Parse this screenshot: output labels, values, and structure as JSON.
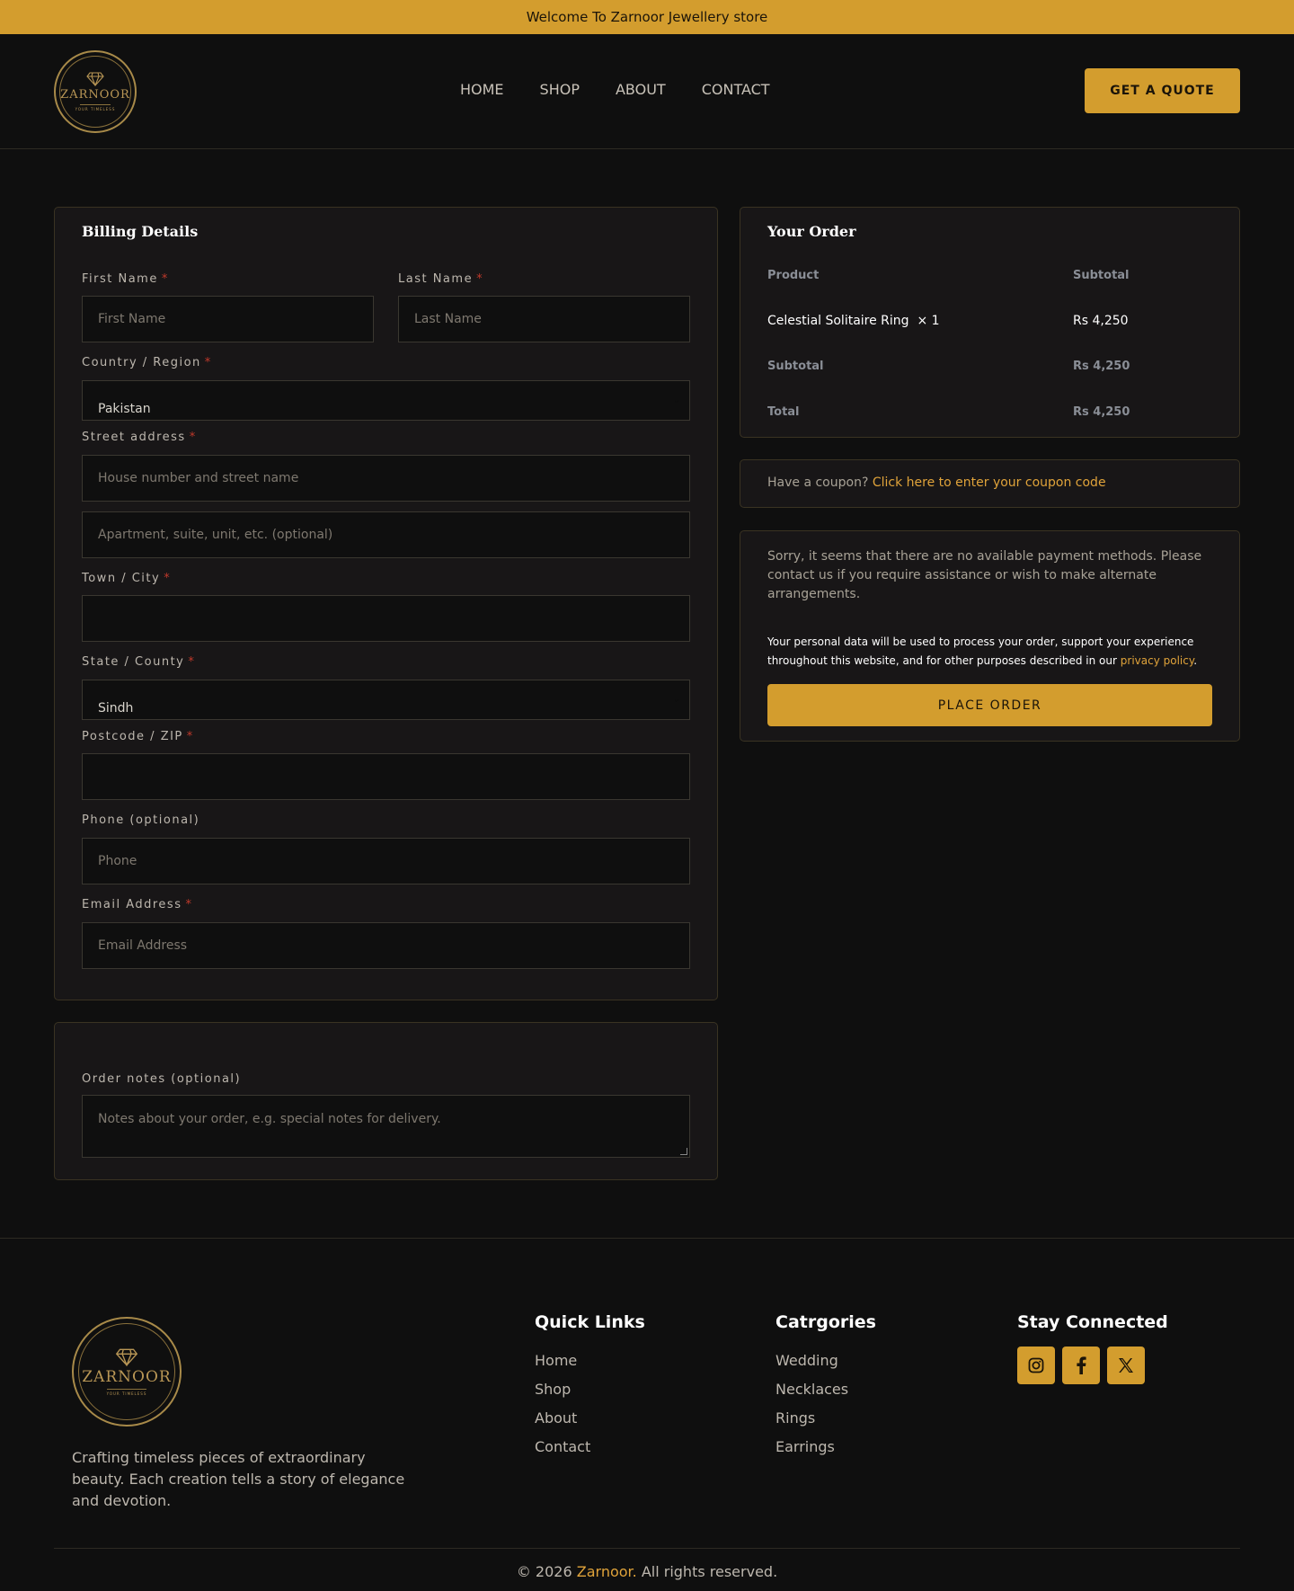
{
  "topbar": {
    "text": "Welcome To Zarnoor Jewellery store"
  },
  "header": {
    "logo_text": "ZARNOOR",
    "logo_tagline": "YOUR TIMELESS",
    "nav": [
      "HOME",
      "SHOP",
      "ABOUT",
      "CONTACT"
    ],
    "quote_button": "GET A QUOTE"
  },
  "billing": {
    "title": "Billing Details",
    "first_name": {
      "label": "First Name",
      "placeholder": "First Name"
    },
    "last_name": {
      "label": "Last Name",
      "placeholder": "Last Name"
    },
    "country": {
      "label": "Country / Region",
      "value": "Pakistan"
    },
    "street": {
      "label": "Street address",
      "placeholder1": "House number and street name",
      "placeholder2": "Apartment, suite, unit, etc. (optional)"
    },
    "city": {
      "label": "Town / City"
    },
    "state": {
      "label": "State / County",
      "value": "Sindh"
    },
    "postcode": {
      "label": "Postcode / ZIP"
    },
    "phone": {
      "label": "Phone (optional)",
      "placeholder": "Phone"
    },
    "email": {
      "label": "Email Address",
      "placeholder": "Email Address"
    },
    "required_mark": "*"
  },
  "notes": {
    "label": "Order notes (optional)",
    "placeholder": "Notes about your order, e.g. special notes for delivery."
  },
  "order": {
    "title": "Your Order",
    "col_product": "Product",
    "col_subtotal": "Subtotal",
    "item_name": "Celestial Solitaire Ring",
    "item_qty": "× 1",
    "item_price": "Rs 4,250",
    "subtotal_label": "Subtotal",
    "subtotal_value": "Rs 4,250",
    "total_label": "Total",
    "total_value": "Rs 4,250"
  },
  "coupon": {
    "prompt": "Have a coupon?",
    "link": "Click here to enter your coupon code"
  },
  "payment": {
    "message": "Sorry, it seems that there are no available payment methods. Please contact us if you require assistance or wish to make alternate arrangements.",
    "privacy_text": "Your personal data will be used to process your order, support your experience throughout this website, and for other purposes described in our",
    "privacy_link": "privacy policy",
    "privacy_end": ".",
    "place_order": "PLACE ORDER"
  },
  "footer": {
    "logo_text": "ZARNOOR",
    "logo_tagline": "YOUR TIMELESS",
    "description": "Crafting timeless pieces of extraordinary beauty. Each creation tells a story of elegance and devotion.",
    "quick_links": {
      "title": "Quick Links",
      "items": [
        "Home",
        "Shop",
        "About",
        "Contact"
      ]
    },
    "categories": {
      "title": "Catrgories",
      "items": [
        "Wedding",
        "Necklaces",
        "Rings",
        "Earrings"
      ]
    },
    "connect": {
      "title": "Stay Connected",
      "icons": [
        "instagram-icon",
        "facebook-icon",
        "x-icon"
      ]
    },
    "copyright_pre": "© 2026",
    "copyright_brand": "Zarnoor.",
    "copyright_post": "All rights reserved."
  },
  "colors": {
    "accent": "#d39d2e",
    "background": "#0f0f0f",
    "card": "#181617",
    "link": "#e0a33a"
  }
}
